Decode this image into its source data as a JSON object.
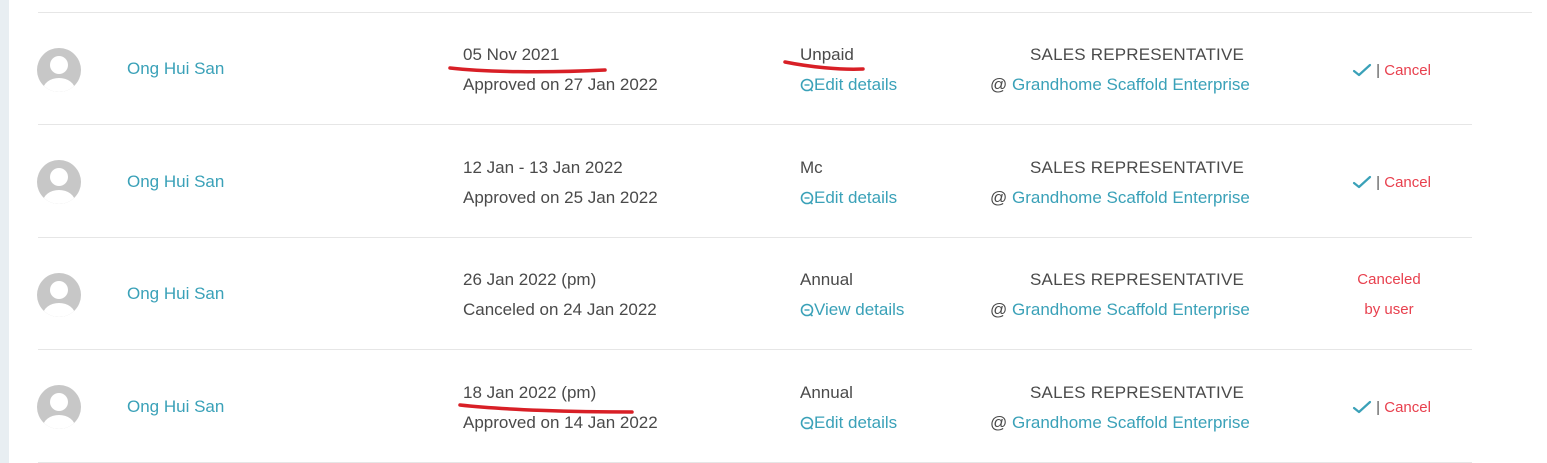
{
  "colors": {
    "link": "#3aa1b8",
    "cancel": "#e8404e",
    "marker": "#d81f26"
  },
  "rows": [
    {
      "name": "Ong Hui San",
      "date_line": "05 Nov 2021",
      "status_line": "Approved on 27 Jan 2022",
      "leave_type": "Unpaid",
      "details_label": "Edit details",
      "role": "SALES REPRESENTATIVE",
      "at": "@",
      "company": "Grandhome Scaffold Enterprise",
      "separator": "|",
      "cancel_label": "Cancel"
    },
    {
      "name": "Ong Hui San",
      "date_line": "12 Jan - 13 Jan 2022",
      "status_line": "Approved on 25 Jan 2022",
      "leave_type": "Mc",
      "details_label": "Edit details",
      "role": "SALES REPRESENTATIVE",
      "at": "@",
      "company": "Grandhome Scaffold Enterprise",
      "separator": "|",
      "cancel_label": "Cancel"
    },
    {
      "name": "Ong Hui San",
      "date_line": "26 Jan 2022 (pm)",
      "status_line": "Canceled on 24 Jan 2022",
      "leave_type": "Annual",
      "details_label": "View details",
      "role": "SALES REPRESENTATIVE",
      "at": "@",
      "company": "Grandhome Scaffold Enterprise",
      "canceled_line1": "Canceled",
      "canceled_line2": "by user"
    },
    {
      "name": "Ong Hui San",
      "date_line": "18 Jan 2022 (pm)",
      "status_line": "Approved on 14 Jan 2022",
      "leave_type": "Annual",
      "details_label": "Edit details",
      "role": "SALES REPRESENTATIVE",
      "at": "@",
      "company": "Grandhome Scaffold Enterprise",
      "separator": "|",
      "cancel_label": "Cancel"
    }
  ]
}
